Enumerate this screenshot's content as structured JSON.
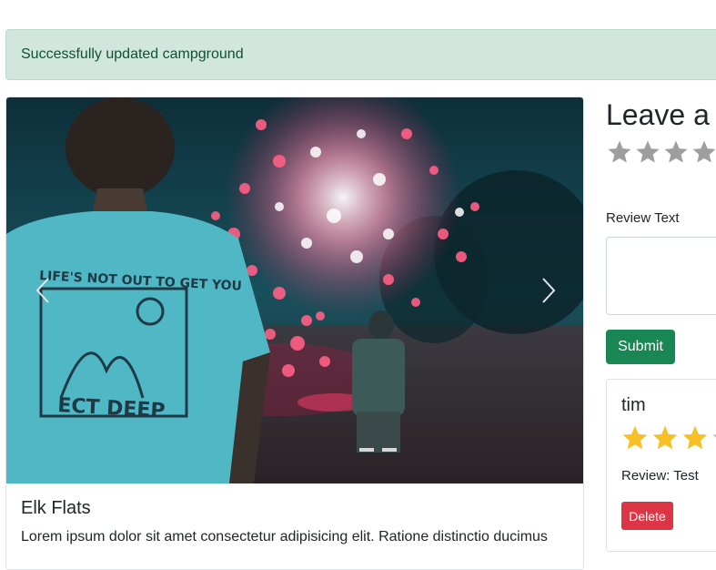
{
  "alert": {
    "message": "Successfully updated campground"
  },
  "campground": {
    "title": "Elk Flats",
    "description": "Lorem ipsum dolor sit amet consectetur adipisicing elit. Ratione distinctio ducimus",
    "photo": {
      "shirt_text_top": "LIFE'S NOT OUT TO GET YOU",
      "shirt_text_bottom": "ECT DEEP"
    }
  },
  "carousel": {
    "prev_icon": "chevron-left-icon",
    "next_icon": "chevron-right-icon"
  },
  "review_form": {
    "heading": "Leave a R",
    "rating_stars": 4,
    "review_text_label": "Review Text",
    "submit_label": "Submit"
  },
  "reviews": [
    {
      "author": "tim",
      "rating": 3,
      "text": "Review: Test",
      "delete_label": "Delete"
    }
  ],
  "colors": {
    "alert_bg": "#d1e7dd",
    "alert_text": "#0f5132",
    "submit": "#198754",
    "delete": "#dc3545",
    "star_gold": "#f6c026",
    "star_gray": "#9e9e9e"
  }
}
